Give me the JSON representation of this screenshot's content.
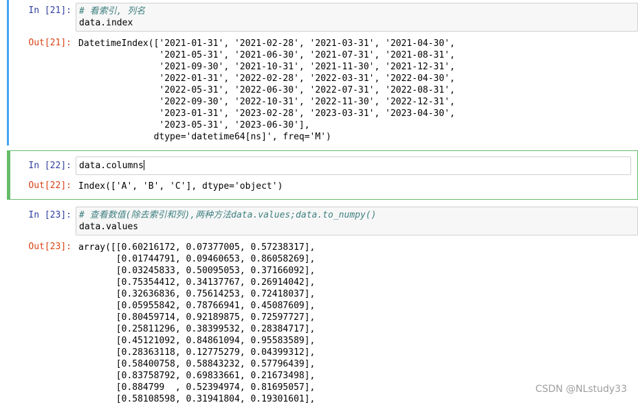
{
  "cells": {
    "c21": {
      "in_prompt": "In [21]:",
      "comment": "# 看索引, 列名",
      "code": "data.index",
      "out_prompt": "Out[21]:",
      "output": [
        "DatetimeIndex(['2021-01-31', '2021-02-28', '2021-03-31', '2021-04-30',",
        "               '2021-05-31', '2021-06-30', '2021-07-31', '2021-08-31',",
        "               '2021-09-30', '2021-10-31', '2021-11-30', '2021-12-31',",
        "               '2022-01-31', '2022-02-28', '2022-03-31', '2022-04-30',",
        "               '2022-05-31', '2022-06-30', '2022-07-31', '2022-08-31',",
        "               '2022-09-30', '2022-10-31', '2022-11-30', '2022-12-31',",
        "               '2023-01-31', '2023-02-28', '2023-03-31', '2023-04-30',",
        "               '2023-05-31', '2023-06-30'],",
        "              dtype='datetime64[ns]', freq='M')"
      ]
    },
    "c22": {
      "in_prompt": "In [22]:",
      "code": "data.columns",
      "out_prompt": "Out[22]:",
      "output": "Index(['A', 'B', 'C'], dtype='object')"
    },
    "c23": {
      "in_prompt": "In [23]:",
      "comment": "# 查看数值(除去索引和列),两种方法data.values;data.to_numpy()",
      "code": "data.values",
      "out_prompt": "Out[23]:",
      "output": [
        "array([[0.60216172, 0.07377005, 0.57238317],",
        "       [0.01744791, 0.09460653, 0.86058269],",
        "       [0.03245833, 0.50095053, 0.37166092],",
        "       [0.75354412, 0.34137767, 0.26914042],",
        "       [0.32636836, 0.75614253, 0.72418037],",
        "       [0.05955842, 0.78766941, 0.45087609],",
        "       [0.80459714, 0.92189875, 0.72597727],",
        "       [0.25811296, 0.38399532, 0.28384717],",
        "       [0.45121092, 0.84861094, 0.95583589],",
        "       [0.28363118, 0.12775279, 0.04399312],",
        "       [0.58400758, 0.58843232, 0.57796439],",
        "       [0.83758792, 0.69833661, 0.21673498],",
        "       [0.884799  , 0.52394974, 0.81695057],",
        "       [0.58108598, 0.31941804, 0.19301601],"
      ]
    }
  },
  "watermark": "CSDN @NLstudy33"
}
